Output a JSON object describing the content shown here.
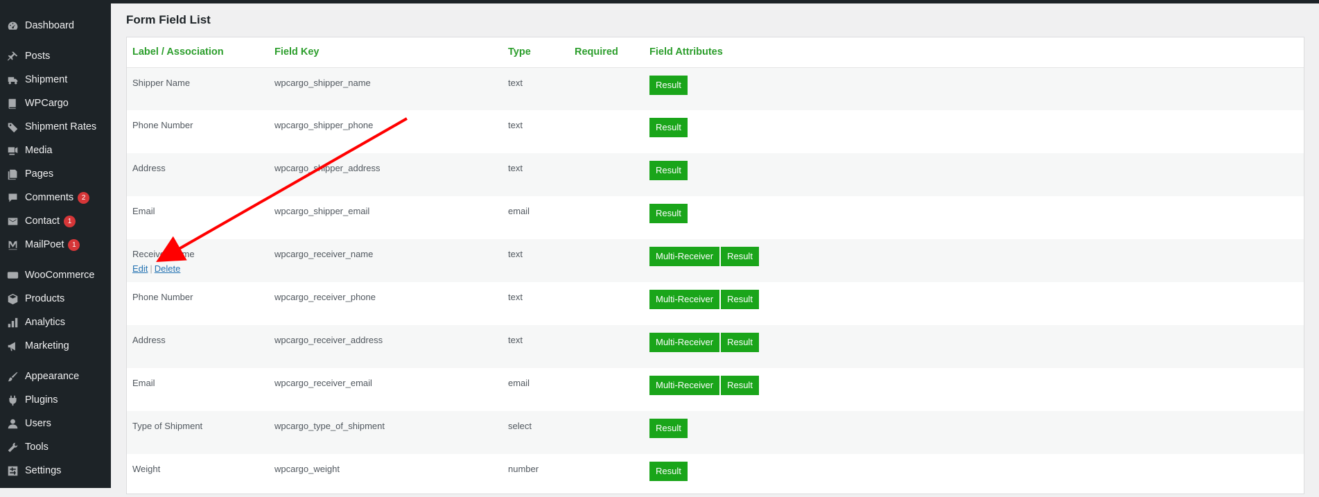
{
  "sidebar": {
    "items": [
      {
        "label": "Dashboard",
        "icon": "dashboard-icon"
      },
      {
        "label": "Posts",
        "icon": "pin-icon"
      },
      {
        "label": "Shipment",
        "icon": "truck-icon"
      },
      {
        "label": "WPCargo",
        "icon": "book-icon"
      },
      {
        "label": "Shipment Rates",
        "icon": "tag-icon"
      },
      {
        "label": "Media",
        "icon": "media-icon"
      },
      {
        "label": "Pages",
        "icon": "pages-icon"
      },
      {
        "label": "Comments",
        "icon": "comment-icon",
        "badge": "2"
      },
      {
        "label": "Contact",
        "icon": "envelope-icon",
        "badge": "1"
      },
      {
        "label": "MailPoet",
        "icon": "mailpoet-icon",
        "badge": "1"
      },
      {
        "label": "WooCommerce",
        "icon": "woo-icon"
      },
      {
        "label": "Products",
        "icon": "cube-icon"
      },
      {
        "label": "Analytics",
        "icon": "bar-chart-icon"
      },
      {
        "label": "Marketing",
        "icon": "megaphone-icon"
      },
      {
        "label": "Appearance",
        "icon": "brush-icon"
      },
      {
        "label": "Plugins",
        "icon": "plug-icon"
      },
      {
        "label": "Users",
        "icon": "user-icon"
      },
      {
        "label": "Tools",
        "icon": "wrench-icon"
      },
      {
        "label": "Settings",
        "icon": "settings-icon"
      }
    ]
  },
  "page": {
    "title": "Form Field List"
  },
  "table": {
    "headers": [
      "Label / Association",
      "Field Key",
      "Type",
      "Required",
      "Field Attributes"
    ],
    "row_actions": {
      "edit": "Edit",
      "sep": "|",
      "delete": "Delete"
    },
    "rows": [
      {
        "label": "Shipper Name",
        "key": "wpcargo_shipper_name",
        "type": "text",
        "required": "",
        "attrs": [
          "Result"
        ]
      },
      {
        "label": "Phone Number",
        "key": "wpcargo_shipper_phone",
        "type": "text",
        "required": "",
        "attrs": [
          "Result"
        ]
      },
      {
        "label": "Address",
        "key": "wpcargo_shipper_address",
        "type": "text",
        "required": "",
        "attrs": [
          "Result"
        ]
      },
      {
        "label": "Email",
        "key": "wpcargo_shipper_email",
        "type": "email",
        "required": "",
        "attrs": [
          "Result"
        ]
      },
      {
        "label": "Receiver Name",
        "key": "wpcargo_receiver_name",
        "type": "text",
        "required": "",
        "attrs": [
          "Multi-Receiver",
          "Result"
        ],
        "show_actions": true
      },
      {
        "label": "Phone Number",
        "key": "wpcargo_receiver_phone",
        "type": "text",
        "required": "",
        "attrs": [
          "Multi-Receiver",
          "Result"
        ]
      },
      {
        "label": "Address",
        "key": "wpcargo_receiver_address",
        "type": "text",
        "required": "",
        "attrs": [
          "Multi-Receiver",
          "Result"
        ]
      },
      {
        "label": "Email",
        "key": "wpcargo_receiver_email",
        "type": "email",
        "required": "",
        "attrs": [
          "Multi-Receiver",
          "Result"
        ]
      },
      {
        "label": "Type of Shipment",
        "key": "wpcargo_type_of_shipment",
        "type": "select",
        "required": "",
        "attrs": [
          "Result"
        ]
      },
      {
        "label": "Weight",
        "key": "wpcargo_weight",
        "type": "number",
        "required": "",
        "attrs": [
          "Result"
        ]
      }
    ]
  },
  "colors": {
    "accent_green": "#1aa51a",
    "header_green": "#2c9e2c",
    "arrow_red": "#ff0000",
    "sidebar_bg": "#1d2327"
  }
}
